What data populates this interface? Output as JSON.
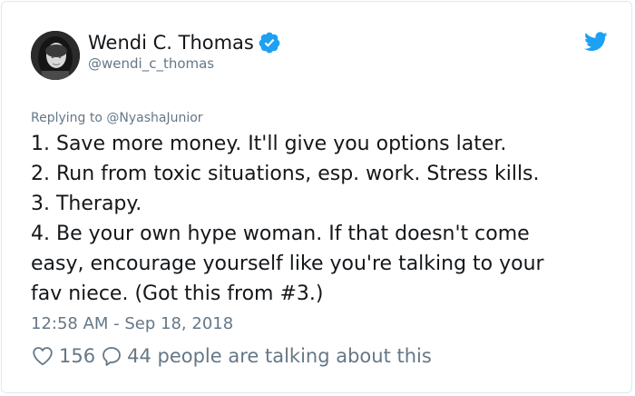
{
  "author": {
    "display_name": "Wendi C. Thomas",
    "handle": "@wendi_c_thomas",
    "verified": true
  },
  "icons": {
    "avatar": "avatar-photo",
    "verified": "verified-badge-icon",
    "brand": "twitter-bird-icon",
    "like": "heart-icon",
    "reply": "speech-bubble-icon"
  },
  "colors": {
    "brand": "#1da1f2",
    "text": "#14171a",
    "muted": "#657786"
  },
  "reply_context": "Replying to @NyashaJunior",
  "tweet": {
    "lines": [
      "1. Save more money. It'll give you options later.",
      "2. Run from toxic situations, esp. work. Stress kills.",
      "3. Therapy.",
      "4. Be your own hype woman. If that doesn't come",
      "easy, encourage yourself like you're talking to your",
      "fav niece. (Got this from #3.)"
    ]
  },
  "timestamp": "12:58 AM - Sep 18, 2018",
  "actions": {
    "like_count": "156",
    "talking_text": "44 people are talking about this"
  }
}
